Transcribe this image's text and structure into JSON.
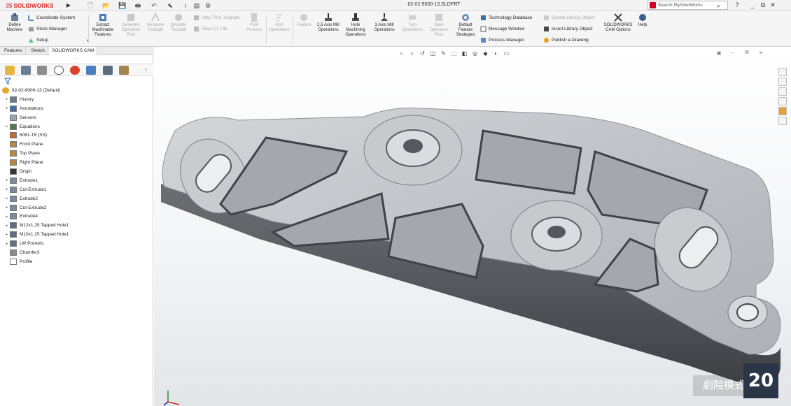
{
  "app": {
    "brand": "SOLIDWORKS",
    "brand_prefix": "3S",
    "document_title": "62-02-9000-13.SLDPRT",
    "search_placeholder": "Search MySolidWorks",
    "window_controls": [
      "?",
      "_",
      "⧉",
      "✕"
    ],
    "accent": "#d22630"
  },
  "commands": {
    "define_machine": "Define Machine",
    "coordinate_system": "Coordinate System",
    "stock_manager": "Stock Manager",
    "setup": "Setup",
    "extract_features": "Extract Machinable Features",
    "generate_plan": "Generate Operation Plan",
    "generate_toolpath": "Generate Toolpath",
    "simulate_toolpath": "Simulate Toolpath",
    "step_thru": "Step Thru Toolpath",
    "save_cl": "Save CL File",
    "post_process": "Post Process",
    "sort_operations": "Sort Operations",
    "feature": "Feature",
    "mill_25": "2.5 Axis Mill Operations",
    "hole_machining": "Hole Machining Operations",
    "mill_3": "3 Axis Mill Operations",
    "turn_operations": "Turn Operations",
    "save_plan": "Save Operation Plan",
    "default_strategies": "Default Feature Strategies",
    "technology_database": "Technology Database",
    "message_window": "Message Window",
    "process_manager": "Process Manager",
    "create_library": "Create Library Object",
    "insert_library": "Insert Library Object",
    "publish_edrawing": "Publish e-Drawing",
    "cam_options": "SOLIDWORKS CAM Options",
    "help": "Help"
  },
  "tabs": [
    "Features",
    "Sketch",
    "SOLIDWORKS CAM"
  ],
  "tree": {
    "root": "62-02-9000-13  (Default)",
    "items": [
      {
        "label": "History",
        "expandable": true
      },
      {
        "label": "Annotations",
        "expandable": true
      },
      {
        "label": "Sensors",
        "expandable": false
      },
      {
        "label": "Equations",
        "expandable": true
      },
      {
        "label": "6061-T6 (SS)",
        "expandable": false
      },
      {
        "label": "Front Plane",
        "expandable": false
      },
      {
        "label": "Top Plane",
        "expandable": false
      },
      {
        "label": "Right Plane",
        "expandable": false
      },
      {
        "label": "Origin",
        "expandable": false
      },
      {
        "label": "Extrude1",
        "expandable": true
      },
      {
        "label": "Cut-Extrude1",
        "expandable": true
      },
      {
        "label": "Extrude2",
        "expandable": true
      },
      {
        "label": "Cut-Extrude2",
        "expandable": true
      },
      {
        "label": "Extrude4",
        "expandable": true
      },
      {
        "label": "M12x1.25 Tapped Hole1",
        "expandable": true
      },
      {
        "label": "M10x1.25 Tapped Hole1",
        "expandable": true
      },
      {
        "label": "LW Pockets",
        "expandable": true
      },
      {
        "label": "Chamfer3",
        "expandable": false
      },
      {
        "label": "Profile",
        "expandable": false
      }
    ]
  },
  "overlay": {
    "watermark": "劇院模式",
    "badge": "20"
  }
}
